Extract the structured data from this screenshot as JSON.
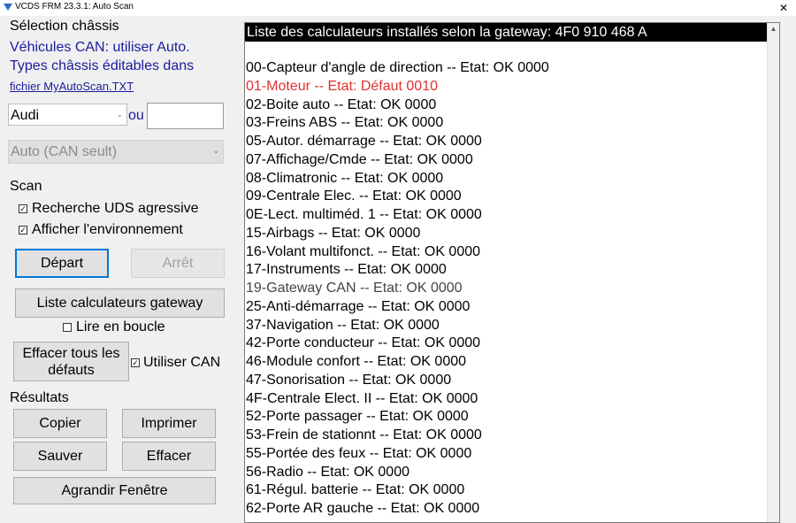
{
  "window": {
    "title": "VCDS FRM 23.3.1:  Auto Scan",
    "close_glyph": "✕"
  },
  "left": {
    "chassis_heading": "Sélection châssis",
    "info_line1": "Véhicules CAN: utiliser Auto.",
    "info_line2": "Types châssis éditables dans",
    "file_link": "fichier MyAutoScan.TXT",
    "make_select": "Audi",
    "or_label": "ou",
    "custom_input": "",
    "chassis_select": "Auto (CAN seult)",
    "scan_heading": "Scan",
    "uds_label": "Recherche UDS agressive",
    "uds_checked": true,
    "env_label": "Afficher l'environnement",
    "env_checked": true,
    "start_button": "Départ",
    "stop_button": "Arrêt",
    "gateway_button": "Liste calculateurs gateway",
    "loop_label": "Lire en boucle",
    "loop_checked": false,
    "clear_faults_line1": "Effacer tous les",
    "clear_faults_line2": "défauts",
    "use_can_label": "Utiliser CAN",
    "use_can_checked": true,
    "results_heading": "Résultats",
    "copy_button": "Copier",
    "print_button": "Imprimer",
    "save_button": "Sauver",
    "clear_button": "Effacer",
    "enlarge_button": "Agrandir Fenêtre"
  },
  "results": {
    "header": "Liste des calculateurs installés selon la gateway:  4F0 910 468 A",
    "rows": [
      {
        "text": "00-Capteur d'angle de direction -- Etat: OK 0000",
        "state": "ok"
      },
      {
        "text": "01-Moteur -- Etat: Défaut 0010",
        "state": "err"
      },
      {
        "text": "02-Boite auto -- Etat: OK 0000",
        "state": "ok"
      },
      {
        "text": "03-Freins ABS -- Etat: OK 0000",
        "state": "ok"
      },
      {
        "text": "05-Autor. démarrage -- Etat: OK 0000",
        "state": "ok"
      },
      {
        "text": "07-Affichage/Cmde -- Etat: OK 0000",
        "state": "ok"
      },
      {
        "text": "08-Climatronic -- Etat: OK 0000",
        "state": "ok"
      },
      {
        "text": "09-Centrale Elec. -- Etat: OK 0000",
        "state": "ok"
      },
      {
        "text": "0E-Lect. multiméd. 1 -- Etat: OK 0000",
        "state": "ok"
      },
      {
        "text": "15-Airbags -- Etat: OK 0000",
        "state": "ok"
      },
      {
        "text": "16-Volant multifonct. -- Etat: OK 0000",
        "state": "ok"
      },
      {
        "text": "17-Instruments -- Etat: OK 0000",
        "state": "ok"
      },
      {
        "text": "19-Gateway CAN -- Etat: OK 0000",
        "state": "gw"
      },
      {
        "text": "25-Anti-démarrage -- Etat: OK 0000",
        "state": "ok"
      },
      {
        "text": "37-Navigation -- Etat: OK 0000",
        "state": "ok"
      },
      {
        "text": "42-Porte conducteur -- Etat: OK 0000",
        "state": "ok"
      },
      {
        "text": "46-Module confort -- Etat: OK 0000",
        "state": "ok"
      },
      {
        "text": "47-Sonorisation -- Etat: OK 0000",
        "state": "ok"
      },
      {
        "text": "4F-Centrale Elect. II -- Etat: OK 0000",
        "state": "ok"
      },
      {
        "text": "52-Porte passager -- Etat: OK 0000",
        "state": "ok"
      },
      {
        "text": "53-Frein de stationnt -- Etat: OK 0000",
        "state": "ok"
      },
      {
        "text": "55-Portée des feux -- Etat: OK 0000",
        "state": "ok"
      },
      {
        "text": "56-Radio -- Etat: OK 0000",
        "state": "ok"
      },
      {
        "text": "61-Régul. batterie -- Etat: OK 0000",
        "state": "ok"
      },
      {
        "text": "62-Porte AR gauche -- Etat: OK 0000",
        "state": "ok"
      }
    ]
  },
  "colors": {
    "error_text": "#e03030",
    "gateway_text": "#444444",
    "info_text": "#1a1a9e",
    "default_button_border": "#0078d7"
  }
}
